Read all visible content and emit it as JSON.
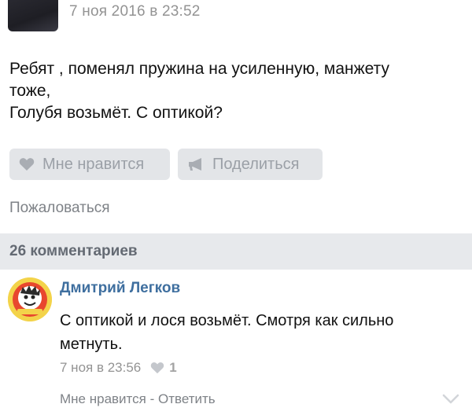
{
  "post": {
    "date": "7 ноя 2016 в 23:52",
    "text_lines": [
      "Ребят , поменял пружина на усиленную, манжету",
      "тоже,",
      "Голубя возьмёт. С оптикой?"
    ],
    "like_label": "Мне нравится",
    "share_label": "Поделиться",
    "report_label": "Пожаловаться"
  },
  "comments_header": {
    "count_label": "26 комментариев"
  },
  "comment": {
    "author": "Дмитрий Легков",
    "text_lines": [
      "С оптикой и лося возьмёт. Смотря как сильно",
      "метнуть."
    ],
    "date": "7 ноя в 23:56",
    "like_count": "1",
    "like_action": "Мне нравится",
    "separator": " - ",
    "reply_action": "Ответить"
  },
  "colors": {
    "link_blue": "#3f6f9f",
    "muted_gray": "#939393",
    "button_bg": "#e3e5e8",
    "section_bg": "#e7e9ec"
  },
  "icons": {
    "like": "heart-icon",
    "share": "megaphone-icon",
    "expand": "chevron-down-icon"
  }
}
